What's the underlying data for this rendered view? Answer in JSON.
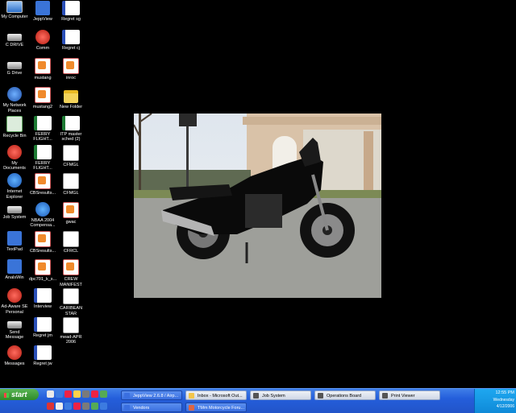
{
  "desktop_icons": [
    {
      "label": "My Computer",
      "icon": "computer-icon"
    },
    {
      "label": "JeppView",
      "icon": "jeppview-icon"
    },
    {
      "label": "Regret sg",
      "icon": "word-doc-icon"
    },
    {
      "label": "C DRIVE",
      "icon": "drive-icon"
    },
    {
      "label": "Comm",
      "icon": "comm-icon"
    },
    {
      "label": "Regret cj",
      "icon": "word-doc-icon"
    },
    {
      "label": "G Drive",
      "icon": "drive-icon"
    },
    {
      "label": "mustang",
      "icon": "image-file-icon"
    },
    {
      "label": "inroc",
      "icon": "image-file-icon"
    },
    {
      "label": "My Network Places",
      "icon": "network-places-icon"
    },
    {
      "label": "mustang2",
      "icon": "image-file-icon"
    },
    {
      "label": "New Folder",
      "icon": "folder-icon"
    },
    {
      "label": "Recycle Bin",
      "icon": "recycle-bin-icon"
    },
    {
      "label": "FERRY FLIGHT...",
      "icon": "excel-doc-icon"
    },
    {
      "label": "ITP master sched (2)",
      "icon": "excel-doc-icon"
    },
    {
      "label": "My Documents",
      "icon": "my-documents-icon"
    },
    {
      "label": "FERRY FLIGHT...",
      "icon": "excel-doc-icon"
    },
    {
      "label": "CFMGL",
      "icon": "document-icon"
    },
    {
      "label": "Internet Explorer",
      "icon": "internet-explorer-icon"
    },
    {
      "label": "CBSresults...",
      "icon": "pdf-doc-icon"
    },
    {
      "label": "CFMGL",
      "icon": "document-icon"
    },
    {
      "label": "Job System",
      "icon": "job-system-icon"
    },
    {
      "label": "NBAA 2004 Compensa...",
      "icon": "internet-shortcut-icon"
    },
    {
      "label": "gwac",
      "icon": "image-file-icon"
    },
    {
      "label": "TextPad",
      "icon": "textpad-icon"
    },
    {
      "label": "CBSresults...",
      "icon": "pdf-doc-icon"
    },
    {
      "label": "CFRCL",
      "icon": "document-icon"
    },
    {
      "label": "AnalsWin",
      "icon": "app-icon"
    },
    {
      "label": "dpc701_k_s...",
      "icon": "image-file-icon"
    },
    {
      "label": "CREW MANIFEST",
      "icon": "image-file-icon"
    },
    {
      "label": "Ad-Aware SE Personal",
      "icon": "ad-aware-icon"
    },
    {
      "label": "Interview",
      "icon": "word-doc-icon"
    },
    {
      "label": "CARIBEAN STAR",
      "icon": "document-icon"
    },
    {
      "label": "Send Message",
      "icon": "send-message-icon"
    },
    {
      "label": "Regret jm",
      "icon": "word-doc-icon"
    },
    {
      "label": "mead-APR 2006",
      "icon": "document-icon"
    },
    {
      "label": "Messages",
      "icon": "messages-icon"
    },
    {
      "label": "Regret jw",
      "icon": "word-doc-icon"
    }
  ],
  "taskbar": {
    "start_label": "start",
    "tasks": [
      {
        "label": "JeppView 2.6.8 / Airp...",
        "icon": "jeppview-task-icon"
      },
      {
        "label": "Inbox - Microsoft Out...",
        "icon": "outlook-task-icon"
      },
      {
        "label": "Job System",
        "icon": "job-system-task-icon"
      },
      {
        "label": "Operations Board",
        "icon": "operations-board-task-icon"
      },
      {
        "label": "Print Viewer",
        "icon": "print-viewer-task-icon"
      },
      {
        "label": "Vendors",
        "icon": "vendors-task-icon"
      },
      {
        "label": "TMm Motorcycle Foru...",
        "icon": "browser-task-icon"
      }
    ],
    "clock": {
      "time": "12:55 PM",
      "day": "Wednesday",
      "date": "4/12/2006"
    }
  },
  "colors": {
    "desktop": "#000000",
    "taskbar": "#245edb",
    "start": "#3c9a36",
    "tray": "#0f8ad8",
    "motorcycle": "#0a0a0a"
  }
}
